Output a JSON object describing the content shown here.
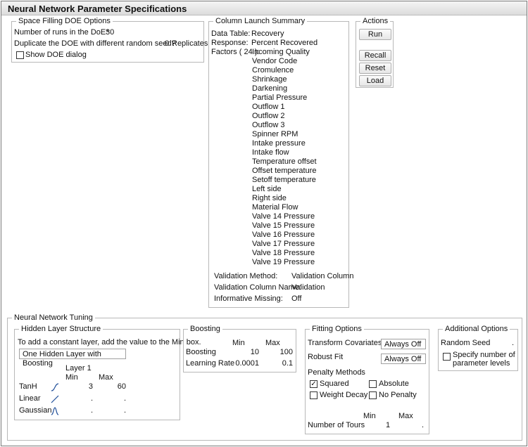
{
  "title": "Neural Network Parameter Specifications",
  "doe": {
    "legend": "Space Filling DOE Options",
    "runs_label": "Number of runs in the DoE*",
    "runs_value": "30",
    "dup_label": "Duplicate the DOE with different random seed?",
    "dup_value": "0",
    "dup_unit": "Replicates",
    "show_dialog": "Show DOE dialog",
    "show_dialog_checked": false
  },
  "summary": {
    "legend": "Column Launch Summary",
    "data_table_label": "Data Table:",
    "data_table": "Recovery",
    "response_label": "Response:",
    "response": "Percent Recovered",
    "factors_label": "Factors ( 24 ):",
    "factors": [
      "Incoming Quality",
      "Vendor Code",
      "Cromulence",
      "Shrinkage",
      "Darkening",
      "Partial Pressure",
      "Outflow 1",
      "Outflow 2",
      "Outflow 3",
      "Spinner RPM",
      "Intake pressure",
      "Intake flow",
      "Temperature offset",
      "Offset temperature",
      "Setoff temperature",
      "Left side",
      "Right side",
      "Material Flow",
      "Valve 14 Pressure",
      "Valve 15 Pressure",
      "Valve 16 Pressure",
      "Valve 17 Pressure",
      "Valve 18 Pressure",
      "Valve 19 Pressure"
    ],
    "validation": [
      {
        "label": "Validation Method:",
        "value": "Validation Column"
      },
      {
        "label": "Validation Column Name:",
        "value": "Validation"
      },
      {
        "label": "Informative Missing:",
        "value": "Off"
      }
    ]
  },
  "actions": {
    "legend": "Actions",
    "run": "Run",
    "recall": "Recall",
    "reset": "Reset",
    "load": "Load"
  },
  "tuning": {
    "legend": "Neural Network Tuning",
    "hidden": {
      "legend": "Hidden Layer Structure",
      "hint": "To add a constant layer, add the value to the Min box.",
      "structure": "One Hidden Layer with Boosting",
      "layer": "Layer 1",
      "min": "Min",
      "max": "Max",
      "rows": [
        {
          "name": "TanH",
          "icon": "tanh-curve-icon",
          "min": "3",
          "max": "60"
        },
        {
          "name": "Linear",
          "icon": "linear-line-icon",
          "min": ".",
          "max": "."
        },
        {
          "name": "Gaussian",
          "icon": "gaussian-curve-icon",
          "min": ".",
          "max": "."
        }
      ]
    },
    "boosting": {
      "legend": "Boosting",
      "min": "Min",
      "max": "Max",
      "rows": [
        {
          "name": "Boosting",
          "min": "10",
          "max": "100"
        },
        {
          "name": "Learning Rate",
          "min": "0.0001",
          "max": "0.1"
        }
      ]
    },
    "fitting": {
      "legend": "Fitting Options",
      "transform_label": "Transform Covariates",
      "transform_value": "Always Off",
      "robust_label": "Robust Fit",
      "robust_value": "Always Off",
      "penalty_label": "Penalty Methods",
      "penalties": [
        {
          "name": "Squared",
          "checked": true
        },
        {
          "name": "Absolute",
          "checked": false
        },
        {
          "name": "Weight Decay",
          "checked": false
        },
        {
          "name": "No Penalty",
          "checked": false
        }
      ],
      "min": "Min",
      "max": "Max",
      "tours_label": "Number of Tours",
      "tours_min": "1",
      "tours_max": "."
    },
    "additional": {
      "legend": "Additional Options",
      "seed_label": "Random Seed",
      "seed_value": ".",
      "levels_label_1": "Specify number of",
      "levels_label_2": "parameter levels",
      "levels_checked": false
    }
  }
}
